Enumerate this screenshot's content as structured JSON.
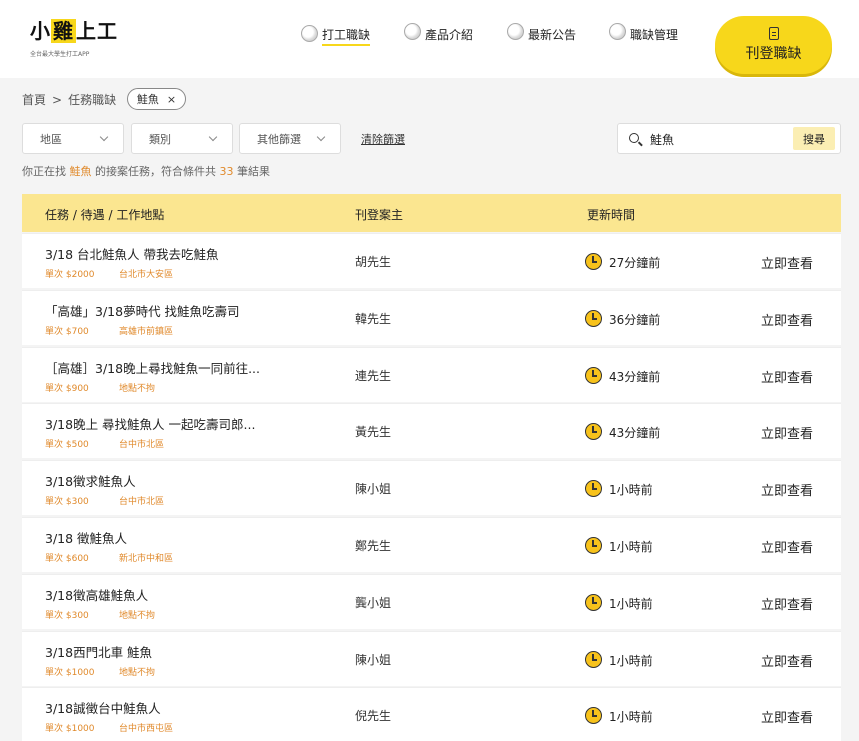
{
  "brand": {
    "name_pre": "小",
    "name_hl": "雞",
    "name_post": "上工",
    "tagline": "全台最大學生打工APP"
  },
  "nav": [
    {
      "label": "打工職缺",
      "active": true
    },
    {
      "label": "產品介紹",
      "active": false
    },
    {
      "label": "最新公告",
      "active": false
    },
    {
      "label": "職缺管理",
      "active": false
    }
  ],
  "post_button": "刊登職缺",
  "breadcrumb": {
    "home": "首頁",
    "sep": ">",
    "current": "任務職缺"
  },
  "active_tag": {
    "label": "鮭魚",
    "remove": "×"
  },
  "filters": {
    "region": "地區",
    "category": "類別",
    "other": "其他篩選",
    "clear": "清除篩選"
  },
  "search": {
    "value": "鮭魚",
    "button": "搜尋"
  },
  "result": {
    "pre": "你正在找",
    "keyword": "鮭魚",
    "mid": "的接案任務，符合條件共",
    "count": "33",
    "post": "筆結果"
  },
  "table": {
    "headers": {
      "task": "任務 / 待遇 / 工作地點",
      "poster": "刊登案主",
      "updated": "更新時間"
    },
    "rows": [
      {
        "title": "3/18 台北鮭魚人 帶我去吃鮭魚",
        "pay": "單次 $2000",
        "location": "台北市大安區",
        "poster": "胡先生",
        "time": "27分鐘前",
        "action": "立即查看"
      },
      {
        "title": "「高雄」3/18夢時代 找鮭魚吃壽司",
        "pay": "單次 $700",
        "location": "高雄市前鎮區",
        "poster": "韓先生",
        "time": "36分鐘前",
        "action": "立即查看"
      },
      {
        "title": "［高雄］3/18晚上尋找鮭魚一同前往...",
        "pay": "單次 $900",
        "location": "地點不拘",
        "poster": "連先生",
        "time": "43分鐘前",
        "action": "立即查看"
      },
      {
        "title": "3/18晚上 尋找鮭魚人 一起吃壽司郎...",
        "pay": "單次 $500",
        "location": "台中市北區",
        "poster": "黃先生",
        "time": "43分鐘前",
        "action": "立即查看"
      },
      {
        "title": "3/18徵求鮭魚人",
        "pay": "單次 $300",
        "location": "台中市北區",
        "poster": "陳小姐",
        "time": "1小時前",
        "action": "立即查看"
      },
      {
        "title": "3/18 徵鮭魚人",
        "pay": "單次 $600",
        "location": "新北市中和區",
        "poster": "鄭先生",
        "time": "1小時前",
        "action": "立即查看"
      },
      {
        "title": "3/18徵高雄鮭魚人",
        "pay": "單次 $300",
        "location": "地點不拘",
        "poster": "龔小姐",
        "time": "1小時前",
        "action": "立即查看"
      },
      {
        "title": "3/18西門北車 鮭魚",
        "pay": "單次 $1000",
        "location": "地點不拘",
        "poster": "陳小姐",
        "time": "1小時前",
        "action": "立即查看"
      },
      {
        "title": "3/18誠徵台中鮭魚人",
        "pay": "單次 $1000",
        "location": "台中市西屯區",
        "poster": "倪先生",
        "time": "1小時前",
        "action": "立即查看"
      }
    ]
  },
  "colors": {
    "accent": "#f7d71b",
    "header_row": "#fbe690",
    "highlight_text": "#e08a2c"
  },
  "icons": {
    "nav": "ball-icon",
    "time": "clock-icon",
    "search": "search-icon",
    "post": "document-icon"
  }
}
